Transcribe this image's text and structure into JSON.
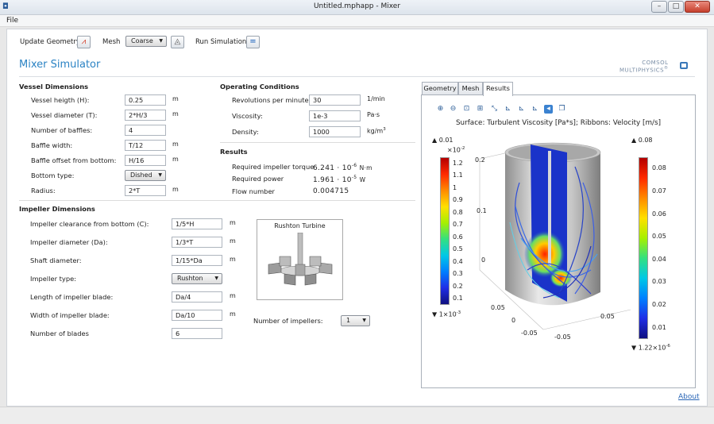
{
  "window": {
    "title": "Untitled.mphapp - Mixer"
  },
  "menu": {
    "file": "File"
  },
  "toolbar": {
    "update_geometry": "Update Geometry",
    "mesh_label": "Mesh",
    "mesh_value": "Coarse",
    "run_simulation": "Run Simulation"
  },
  "app": {
    "title": "Mixer Simulator",
    "brand_line1": "COMSOL",
    "brand_line2": "MULTIPHYSICS",
    "brand_mark": "®"
  },
  "vessel": {
    "heading": "Vessel Dimensions",
    "rows": [
      {
        "label": "Vessel heigth (H):",
        "value": "0.25",
        "unit": "m"
      },
      {
        "label": "Vessel diameter (T):",
        "value": "2*H/3",
        "unit": "m"
      },
      {
        "label": "Number of baffles:",
        "value": "4",
        "unit": ""
      },
      {
        "label": "Baffle width:",
        "value": "T/12",
        "unit": "m"
      },
      {
        "label": "Baffle offset from bottom:",
        "value": "H/16",
        "unit": "m"
      },
      {
        "label": "Bottom type:",
        "value": "Dished",
        "unit": ""
      },
      {
        "label": "Radius:",
        "value": "2*T",
        "unit": "m"
      }
    ]
  },
  "operating": {
    "heading": "Operating Conditions",
    "rows": [
      {
        "label": "Revolutions per minute:",
        "value": "30",
        "unit": "1/min"
      },
      {
        "label": "Viscosity:",
        "value": "1e-3",
        "unit": "Pa·s"
      },
      {
        "label": "Density:",
        "value": "1000",
        "unit": "kg/m",
        "unit_sup": "3"
      }
    ]
  },
  "results": {
    "heading": "Results",
    "torque": {
      "label": "Required impeller torque",
      "mantissa": "6.241 · 10",
      "exp": "-6",
      "unit": "N·m"
    },
    "power": {
      "label": "Required power",
      "mantissa": "1.961 · 10",
      "exp": "-5",
      "unit": "W"
    },
    "flow": {
      "label": "Flow number",
      "value": "0.004715"
    }
  },
  "impeller": {
    "heading": "Impeller Dimensions",
    "rows": [
      {
        "label": "Impeller clearance from bottom (C):",
        "value": "1/5*H",
        "unit": "m"
      },
      {
        "label": "Impeller diameter (Da):",
        "value": "1/3*T",
        "unit": "m"
      },
      {
        "label": "Shaft diameter:",
        "value": "1/15*Da",
        "unit": "m"
      },
      {
        "label": "Impeller type:",
        "value": "Rushton",
        "unit": ""
      },
      {
        "label": "Length of impeller blade:",
        "value": "Da/4",
        "unit": "m"
      },
      {
        "label": "Width of impeller blade:",
        "value": "Da/10",
        "unit": "m"
      },
      {
        "label": "Number of blades",
        "value": "6",
        "unit": ""
      }
    ],
    "image_title": "Rushton Turbine",
    "num_impellers_label": "Number of impellers:",
    "num_impellers_value": "1"
  },
  "tabs": [
    "Geometry",
    "Mesh",
    "Results"
  ],
  "plot": {
    "title": "Surface: Turbulent Viscosity [Pa*s]; Ribbons: Velocity [m/s]",
    "left_bar": {
      "max": "▲ 0.01",
      "scale": "×10",
      "scale_exp": "-2",
      "ticks": [
        "1.2",
        "1.1",
        "1",
        "0.9",
        "0.8",
        "0.7",
        "0.6",
        "0.5",
        "0.4",
        "0.3",
        "0.2",
        "0.1"
      ],
      "min": "▼ 1×10",
      "min_exp": "-3"
    },
    "right_bar": {
      "max": "▲ 0.08",
      "ticks": [
        "0.08",
        "0.07",
        "0.06",
        "0.05",
        "0.04",
        "0.03",
        "0.02",
        "0.01"
      ],
      "min": "▼ 1.22×10",
      "min_exp": "-6"
    },
    "axis_labels": {
      "z1": "0.2",
      "z2": "0.1",
      "z3": "0",
      "x1": "0.05",
      "x2": "0",
      "x3": "-0.05",
      "y1": "-0.05",
      "y2": "0.05"
    }
  },
  "footer": {
    "about": "About"
  },
  "colors": {
    "accent": "#2b83c4",
    "link": "#2a66b6"
  }
}
